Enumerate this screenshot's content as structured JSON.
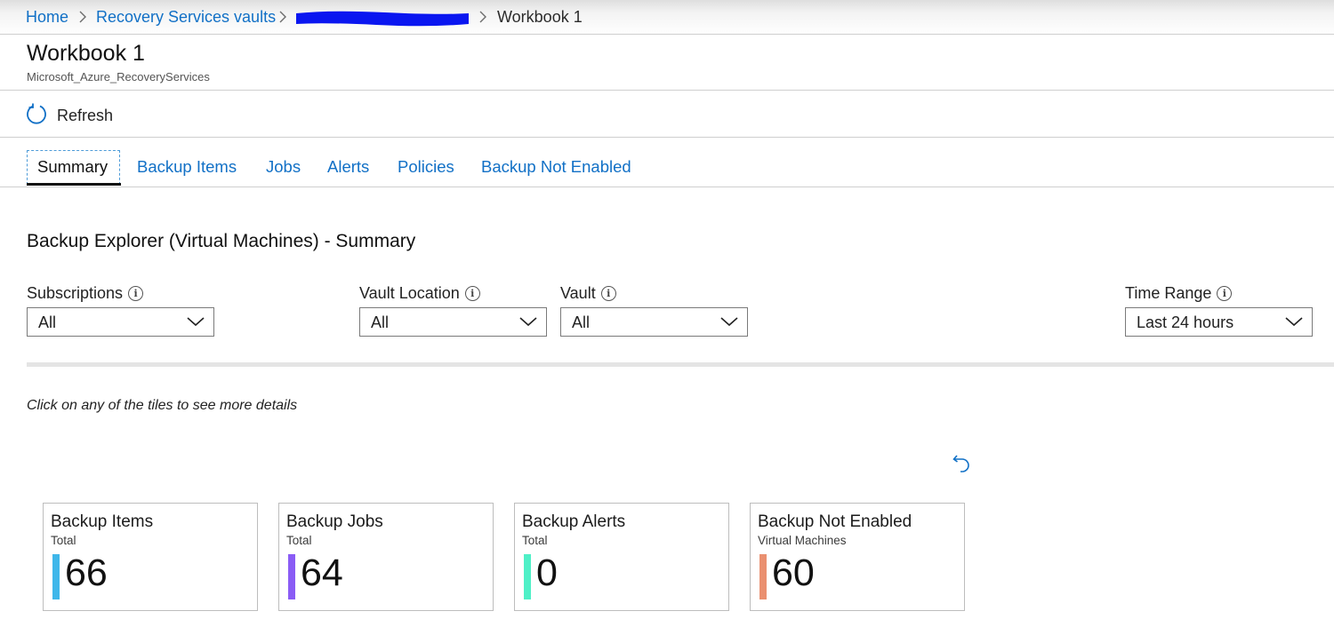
{
  "breadcrumb": {
    "home": "Home",
    "vaults": "Recovery Services vaults",
    "current": "Workbook 1"
  },
  "header": {
    "title": "Workbook 1",
    "subtitle": "Microsoft_Azure_RecoveryServices"
  },
  "toolbar": {
    "refresh_label": "Refresh"
  },
  "tabs": [
    {
      "label": "Summary",
      "active": true
    },
    {
      "label": "Backup Items",
      "active": false
    },
    {
      "label": "Jobs",
      "active": false
    },
    {
      "label": "Alerts",
      "active": false
    },
    {
      "label": "Policies",
      "active": false
    },
    {
      "label": "Backup Not Enabled",
      "active": false
    }
  ],
  "section": {
    "title": "Backup Explorer (Virtual Machines) - Summary"
  },
  "parameters": {
    "subscriptions": {
      "label": "Subscriptions",
      "value": "All"
    },
    "vault_location": {
      "label": "Vault Location",
      "value": "All"
    },
    "vault": {
      "label": "Vault",
      "value": "All"
    },
    "time_range": {
      "label": "Time Range",
      "value": "Last 24 hours"
    }
  },
  "hint": "Click on any of the tiles to see more details",
  "tiles": [
    {
      "title": "Backup Items",
      "subtitle": "Total",
      "value": "66",
      "color": "#3fb7ea"
    },
    {
      "title": "Backup Jobs",
      "subtitle": "Total",
      "value": "64",
      "color": "#8a5cf5"
    },
    {
      "title": "Backup Alerts",
      "subtitle": "Total",
      "value": "0",
      "color": "#4ff0c7"
    },
    {
      "title": "Backup Not Enabled",
      "subtitle": "Virtual Machines",
      "value": "60",
      "color": "#ea9070"
    }
  ],
  "colors": {
    "link": "#1170c6",
    "redaction": "#0a16f0"
  },
  "icons": {
    "refresh": "refresh-icon",
    "info": "info-icon",
    "chevron": "chevron-down-icon",
    "undo": "undo-icon"
  }
}
